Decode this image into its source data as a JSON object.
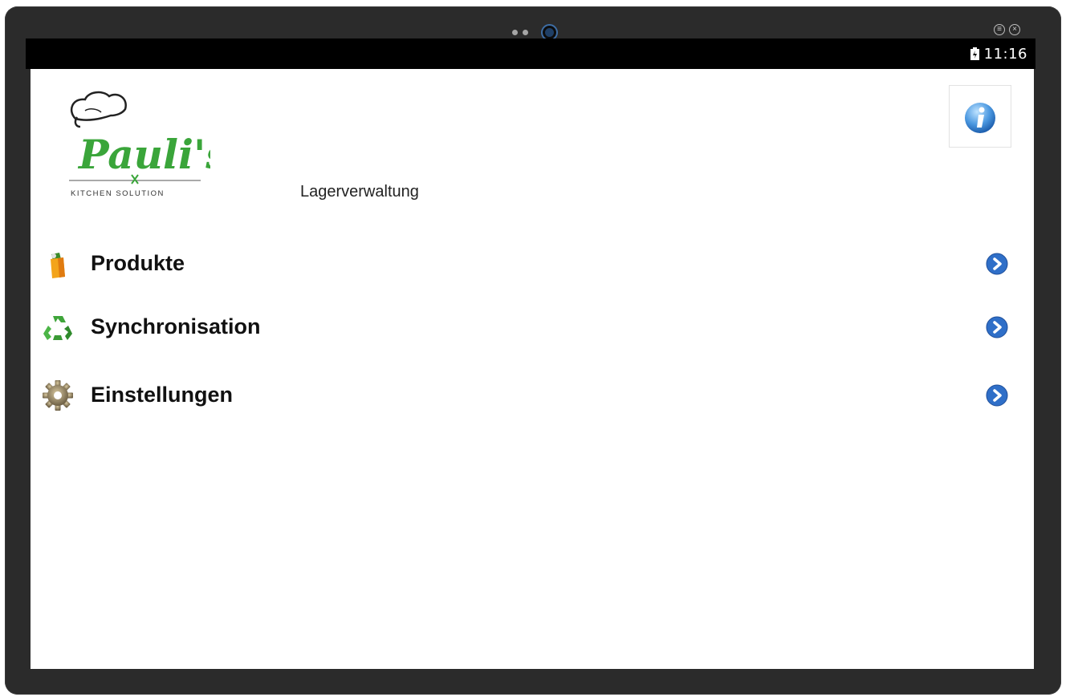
{
  "device": {
    "status_time": "11:16"
  },
  "app": {
    "brand": "Pauli's",
    "brand_tagline": "KITCHEN SOLUTION",
    "subtitle": "Lagerverwaltung"
  },
  "menu": [
    {
      "label": "Produkte",
      "icon": "shopping-bag-icon"
    },
    {
      "label": "Synchronisation",
      "icon": "recycle-icon"
    },
    {
      "label": "Einstellungen",
      "icon": "gear-icon"
    }
  ],
  "colors": {
    "brand_green": "#3aa53a",
    "arrow_blue": "#2f6fc8",
    "statusbar": "#000000"
  }
}
